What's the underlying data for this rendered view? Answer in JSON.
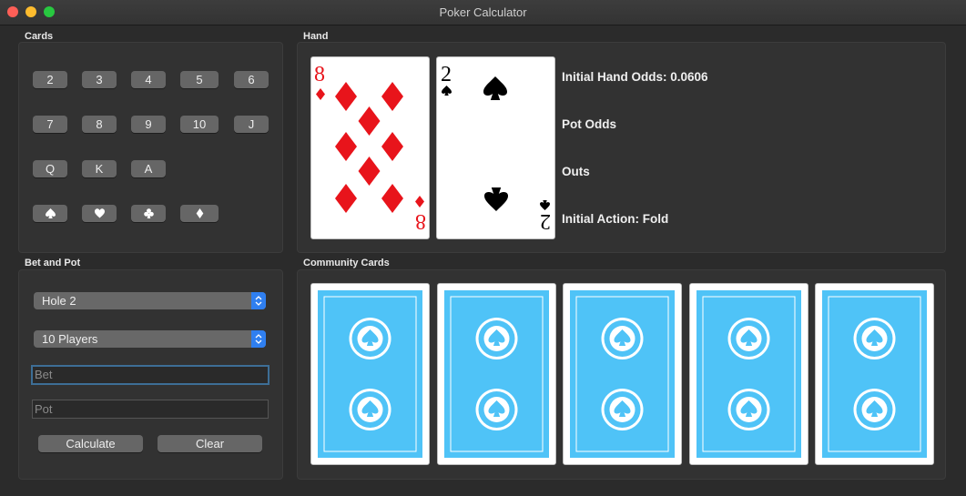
{
  "window": {
    "title": "Poker Calculator"
  },
  "sections": {
    "cards": "Cards",
    "hand": "Hand",
    "bet_and_pot": "Bet and Pot",
    "community_cards": "Community Cards"
  },
  "rank_buttons": [
    "2",
    "3",
    "4",
    "5",
    "6",
    "7",
    "8",
    "9",
    "10",
    "J",
    "Q",
    "K",
    "A"
  ],
  "suit_buttons": [
    "spade-icon",
    "heart-icon",
    "club-icon",
    "diamond-icon"
  ],
  "bet_pot": {
    "hole_select": "Hole 2",
    "players_select": "10 Players",
    "bet_placeholder": "Bet",
    "pot_placeholder": "Pot",
    "calculate_label": "Calculate",
    "clear_label": "Clear"
  },
  "hand": {
    "card1": {
      "rank": "8",
      "suit": "diamond",
      "color": "#e8141b"
    },
    "card2": {
      "rank": "2",
      "suit": "spade",
      "color": "#000000"
    }
  },
  "info": {
    "initial_hand_odds": "Initial Hand Odds: 0.0606",
    "pot_odds": "Pot Odds",
    "outs": "Outs",
    "initial_action": "Initial Action: Fold"
  },
  "community": {
    "card_back_color": "#4fc3f7",
    "count": 5
  }
}
